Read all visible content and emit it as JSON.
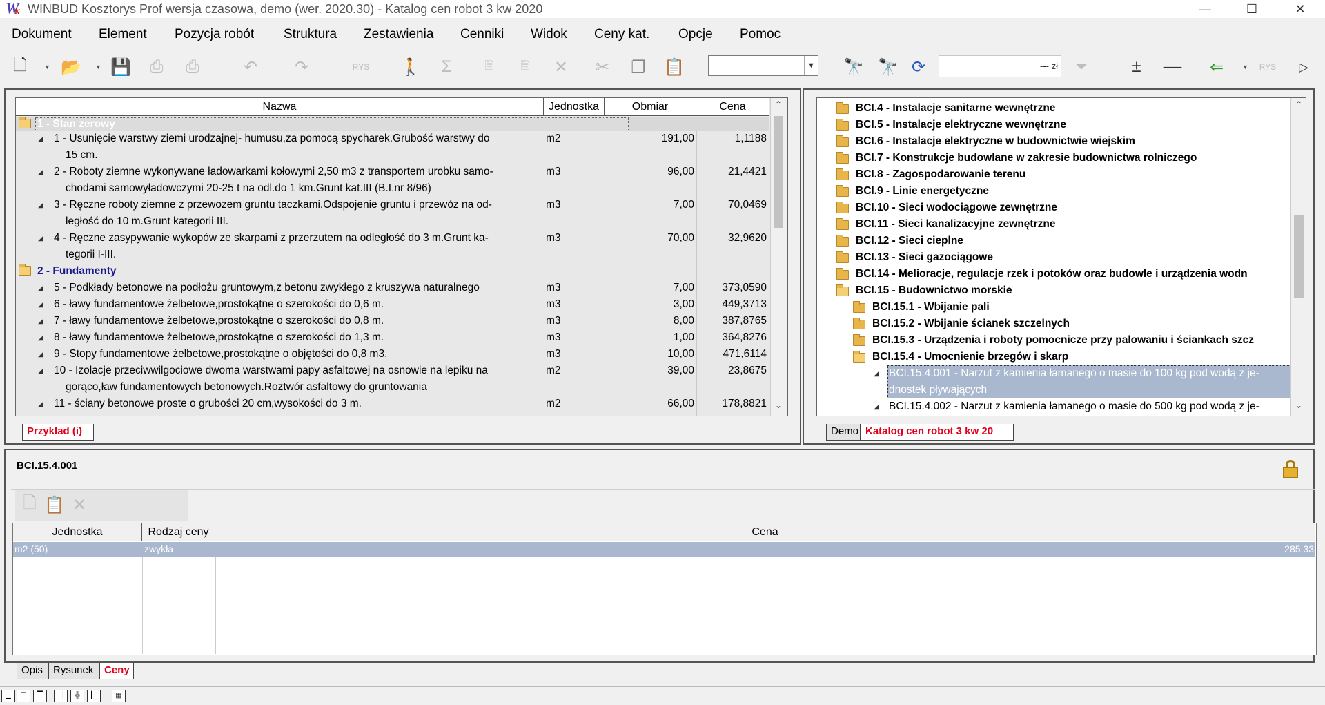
{
  "window": {
    "title": "WINBUD Kosztorys Prof wersja czasowa, demo (wer. 2020.30) - Katalog cen robot 3 kw 2020",
    "minimize": "—",
    "maximize": "☐",
    "close": "✕"
  },
  "menu": [
    "Dokument",
    "Element",
    "Pozycja robót",
    "Struktura",
    "Zestawienia",
    "Cenniki",
    "Widok",
    "Ceny kat.",
    "Opcje",
    "Pomoc"
  ],
  "toolbar": {
    "price_field": "--- zł"
  },
  "estimate": {
    "columns": [
      "Nazwa",
      "Jednostka",
      "Obmiar",
      "Cena"
    ],
    "chapters": [
      {
        "title": "1 - Stan zerowy"
      },
      {
        "title": "2 - Fundamenty"
      }
    ],
    "items": [
      {
        "line1": "1 - Usunięcie warstwy ziemi urodzajnej- humusu,za pomocą spycharek.Grubość warstwy do",
        "line2": "15 cm.",
        "unit": "m2",
        "qty": "191,00",
        "price": "1,1188"
      },
      {
        "line1": "2 - Roboty ziemne wykonywane ładowarkami kołowymi 2,50 m3 z transportem urobku samo-",
        "line2": "chodami samowyładowczymi 20-25 t na odl.do 1 km.Grunt kat.III (B.I.nr 8/96)",
        "unit": "m3",
        "qty": "96,00",
        "price": "21,4421"
      },
      {
        "line1": "3 - Ręczne roboty ziemne z przewozem gruntu taczkami.Odspojenie gruntu i przewóz na od-",
        "line2": "ległość do 10 m.Grunt kategorii III.",
        "unit": "m3",
        "qty": "7,00",
        "price": "70,0469"
      },
      {
        "line1": "4 - Ręczne zasypywanie wykopów ze skarpami z przerzutem na odległość do 3 m.Grunt ka-",
        "line2": "tegorii I-III.",
        "unit": "m3",
        "qty": "70,00",
        "price": "32,9620"
      },
      {
        "line1": "5 - Podkłady betonowe na podłożu gruntowym,z betonu zwykłego z kruszywa naturalnego",
        "line2": "",
        "unit": "m3",
        "qty": "7,00",
        "price": "373,0590"
      },
      {
        "line1": "6 - ławy fundamentowe żelbetowe,prostokątne o szerokości do 0,6 m.",
        "line2": "",
        "unit": "m3",
        "qty": "3,00",
        "price": "449,3713"
      },
      {
        "line1": "7 - ławy fundamentowe żelbetowe,prostokątne o szerokości do 0,8 m.",
        "line2": "",
        "unit": "m3",
        "qty": "8,00",
        "price": "387,8765"
      },
      {
        "line1": "8 - ławy fundamentowe żelbetowe,prostokątne o szerokości do 1,3 m.",
        "line2": "",
        "unit": "m3",
        "qty": "1,00",
        "price": "364,8276"
      },
      {
        "line1": "9 - Stopy fundamentowe żelbetowe,prostokątne o objętości do 0,8 m3.",
        "line2": "",
        "unit": "m3",
        "qty": "10,00",
        "price": "471,6114"
      },
      {
        "line1": "10 - Izolacje przeciwwilgociowe dwoma warstwami papy asfaltowej na osnowie na lepiku na",
        "line2": "gorąco,ław fundamentowych betonowych.Roztwór asfaltowy do gruntowania",
        "unit": "m2",
        "qty": "39,00",
        "price": "23,8675"
      },
      {
        "line1": "11 - ściany betonowe proste o grubości 20 cm,wysokości do 3 m.",
        "line2": "",
        "unit": "m2",
        "qty": "66,00",
        "price": "178,8821"
      }
    ],
    "tab": "Przyklad (i)"
  },
  "catalog": {
    "nodes": [
      "BCI.4 - Instalacje sanitarne wewnętrzne",
      "BCI.5 - Instalacje elektryczne wewnętrzne",
      "BCI.6 - Instalacje elektryczne w budownictwie wiejskim",
      "BCI.7 - Konstrukcje budowlane w zakresie budownictwa rolniczego",
      "BCI.8 - Zagospodarowanie terenu",
      "BCI.9 - Linie energetyczne",
      "BCI.10 - Sieci wodociągowe zewnętrzne",
      "BCI.11 - Sieci kanalizacyjne zewnętrzne",
      "BCI.12 - Sieci cieplne",
      "BCI.13 - Sieci gazociągowe",
      "BCI.14 - Melioracje, regulacje rzek i potoków oraz budowle i urządzenia wodn",
      "BCI.15 - Budownictwo morskie"
    ],
    "subnodes": [
      "BCI.15.1 - Wbijanie pali",
      "BCI.15.2 - Wbijanie ścianek szczelnych",
      "BCI.15.3 - Urządzenia i roboty pomocnicze przy palowaniu i ściankach szcz",
      "BCI.15.4 - Umocnienie brzegów i skarp"
    ],
    "items": [
      {
        "line1": "BCI.15.4.001 - Narzut z kamienia łamanego o masie do 100 kg pod wodą z je-",
        "line2": "dnostek pływających"
      },
      {
        "line1": "BCI.15.4.002 - Narzut z kamienia łamanego o masie do 500 kg pod wodą z je-",
        "line2": ""
      }
    ],
    "tabs": [
      "Demo",
      "Katalog cen robot 3 kw 20"
    ]
  },
  "detail": {
    "code": "BCI.15.4.001",
    "columns": [
      "Jednostka",
      "Rodzaj ceny",
      "Cena"
    ],
    "row": {
      "unit": "m2 (50)",
      "type": "zwykła",
      "price": "285,33"
    },
    "tabs": [
      "Opis",
      "Rysunek",
      "Ceny"
    ]
  },
  "colors": {
    "selection": "#a9b8cf",
    "chapter_text": "#1a1a8c",
    "active_tab_text": "#e0001a"
  }
}
